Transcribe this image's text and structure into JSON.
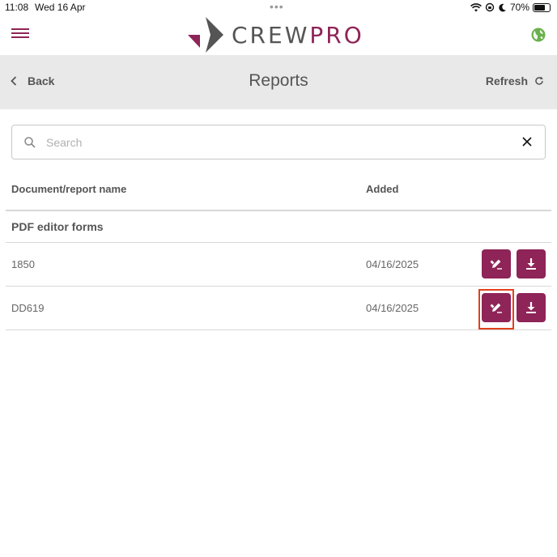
{
  "status_bar": {
    "time": "11:08",
    "date": "Wed 16 Apr",
    "dots": "•••",
    "battery_percent": "70%",
    "battery_level": 0.7
  },
  "header": {
    "logo_text_a": "CREW",
    "logo_text_b": "PRO",
    "menu_icon": "hamburger-icon",
    "globe_icon": "globe-icon"
  },
  "nav": {
    "back_label": "Back",
    "title": "Reports",
    "refresh_label": "Refresh"
  },
  "search": {
    "placeholder": "Search",
    "value": ""
  },
  "table": {
    "columns": [
      "Document/report name",
      "Added"
    ],
    "group_label": "PDF editor forms",
    "rows": [
      {
        "name": "1850",
        "added": "04/16/2025"
      },
      {
        "name": "DD619",
        "added": "04/16/2025"
      }
    ]
  },
  "colors": {
    "brand": "#8e2457",
    "logo_gray": "#555555",
    "nav_bg": "#e9e9e9",
    "highlight": "#e2401c",
    "globe_green": "#6ab04c"
  }
}
